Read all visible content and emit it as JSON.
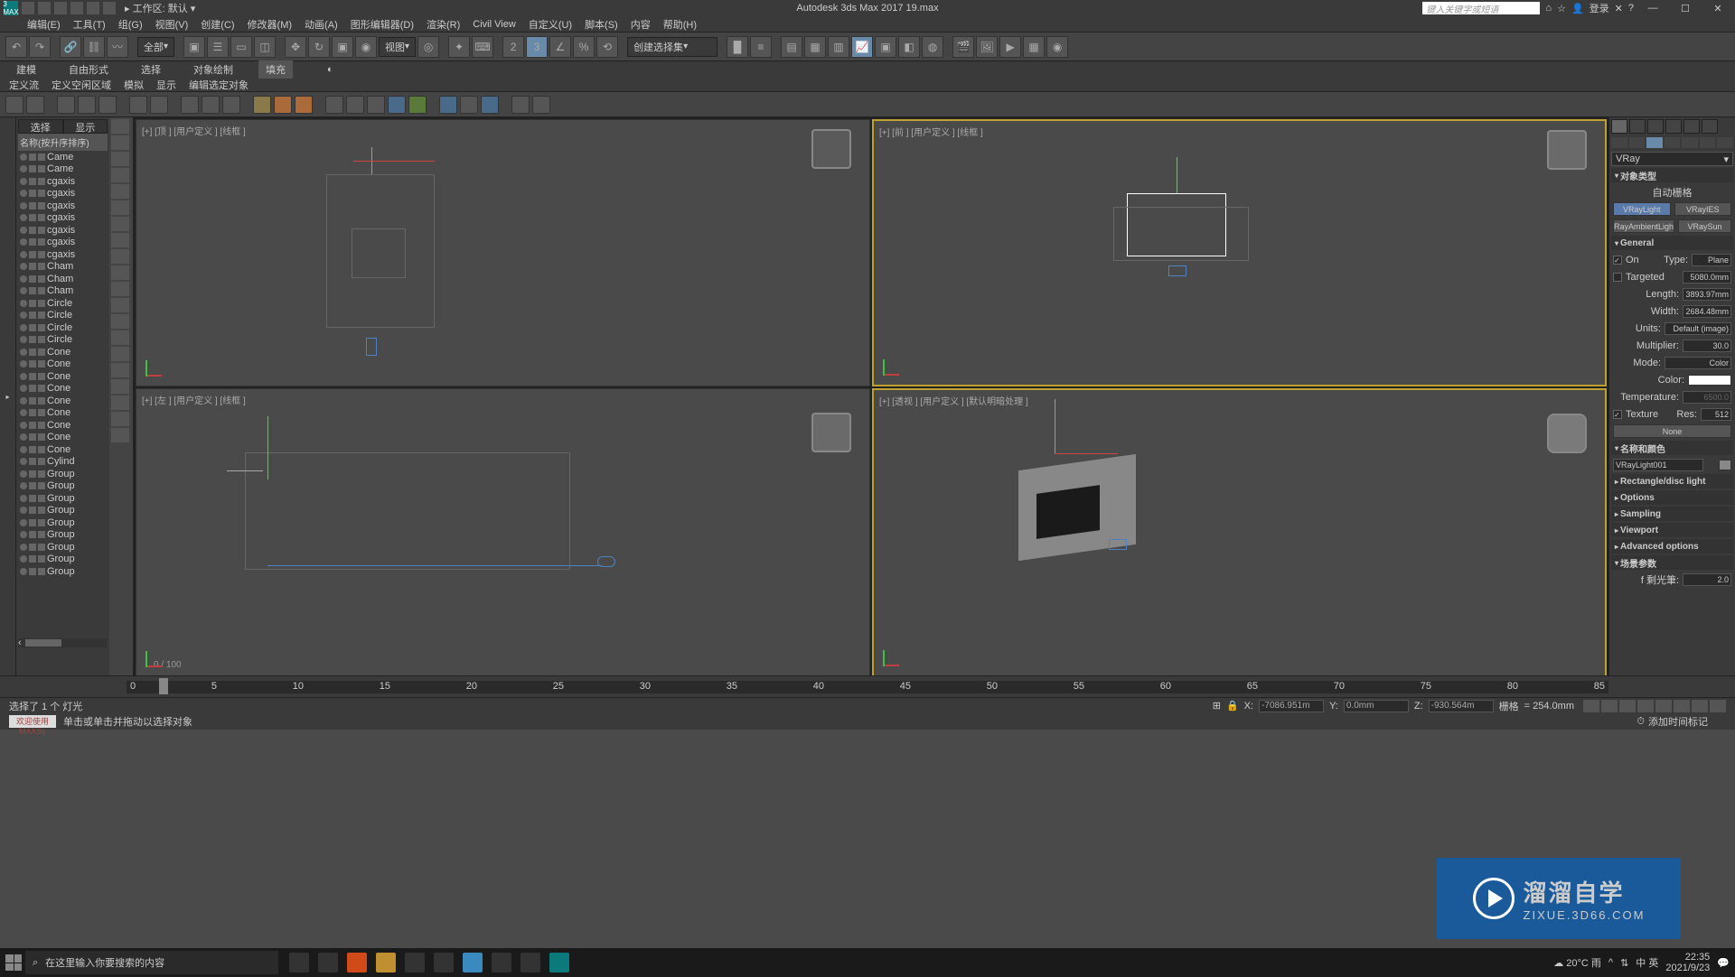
{
  "title_bar": {
    "app_text": "3\nMAX",
    "workspace_label": "工作区: 默认",
    "title": "Autodesk 3ds Max 2017   19.max",
    "search_placeholder": "键入关键字或短语",
    "login_label": "登录"
  },
  "main_menu": [
    "编辑(E)",
    "工具(T)",
    "组(G)",
    "视图(V)",
    "创建(C)",
    "修改器(M)",
    "动画(A)",
    "图形编辑器(D)",
    "渲染(R)",
    "Civil View",
    "自定义(U)",
    "脚本(S)",
    "内容",
    "帮助(H)"
  ],
  "main_toolbar": {
    "filter_label": "全部",
    "view_label": "视图",
    "selset_label": "创建选择集"
  },
  "ribbon_tabs": [
    "建模",
    "自由形式",
    "选择",
    "对象绘制",
    "填充"
  ],
  "ribbon_sub": [
    "定义流",
    "定义空闲区域",
    "模拟",
    "显示",
    "编辑选定对象"
  ],
  "scene": {
    "tabs": [
      "选择",
      "显示"
    ],
    "header": "名称(按升序排序)",
    "items": [
      "Came",
      "Came",
      "cgaxis",
      "cgaxis",
      "cgaxis",
      "cgaxis",
      "cgaxis",
      "cgaxis",
      "cgaxis",
      "Cham",
      "Cham",
      "Cham",
      "Circle",
      "Circle",
      "Circle",
      "Circle",
      "Cone",
      "Cone",
      "Cone",
      "Cone",
      "Cone",
      "Cone",
      "Cone",
      "Cone",
      "Cone",
      "Cylind",
      "Group",
      "Group",
      "Group",
      "Group",
      "Group",
      "Group",
      "Group",
      "Group",
      "Group"
    ]
  },
  "viewports": {
    "top": "[+] [顶 ] [用户定义 ] [线框 ]",
    "front": "[+] [前 ] [用户定义 ] [线框 ]",
    "left": "[+] [左 ] [用户定义 ] [线框 ]",
    "persp": "[+] [透视 ] [用户定义 ] [默认明暗处理 ]"
  },
  "timeline": {
    "counter": "0 / 100",
    "ticks": [
      "0",
      "5",
      "10",
      "15",
      "20",
      "25",
      "30",
      "35",
      "40",
      "45",
      "50",
      "55",
      "60",
      "65",
      "70",
      "75",
      "80",
      "85"
    ]
  },
  "status": {
    "msg1": "选择了 1 个 灯光",
    "maxscript": "欢迎使用 MAXSc",
    "msg2": "单击或单击并拖动以选择对象",
    "x": "-7086.951m",
    "y": "0.0mm",
    "z": "-930.564m",
    "grid_label": "栅格",
    "grid_val": "= 254.0mm",
    "add_time": "添加时间标记"
  },
  "right_panel": {
    "category": "VRay",
    "sec_objtype": "对象类型",
    "autogrid": "自动栅格",
    "btn_vraylight": "VRayLight",
    "btn_vrayies": "VRayIES",
    "btn_rayambient": "RayAmbientLigh",
    "btn_vraysun": "VRaySun",
    "sec_general": "General",
    "on_label": "On",
    "type_label": "Type:",
    "type_value": "Plane",
    "targeted_label": "Targeted",
    "targeted_val": "5080.0mm",
    "length_label": "Length:",
    "length_val": "3893.97mm",
    "width_label": "Width:",
    "width_val": "2684.48mm",
    "units_label": "Units:",
    "units_val": "Default (image)",
    "multiplier_label": "Multiplier:",
    "multiplier_val": "30.0",
    "mode_label": "Mode:",
    "mode_val": "Color",
    "color_label": "Color:",
    "temp_label": "Temperature:",
    "temp_val": "6500.0",
    "texture_label": "Texture",
    "res_label": "Res:",
    "res_val": "512",
    "none_label": "None",
    "sec_name": "名称和颜色",
    "name_val": "VRayLight001",
    "sec_rect": "Rectangle/disc light",
    "sec_options": "Options",
    "sec_sampling": "Sampling",
    "sec_viewport": "Viewport",
    "sec_advanced": "Advanced options",
    "sec_sceneparam": "场景参数",
    "halflen_label": "f 剩光筆:",
    "halflen_val": "2.0"
  },
  "watermark": {
    "cn": "溜溜自学",
    "en": "ZIXUE.3D66.COM"
  },
  "taskbar": {
    "search_placeholder": "在这里输入你要搜索的内容",
    "weather": "20°C 雨",
    "ime": "中 英",
    "time": "22:35",
    "date": "2021/9/23"
  }
}
